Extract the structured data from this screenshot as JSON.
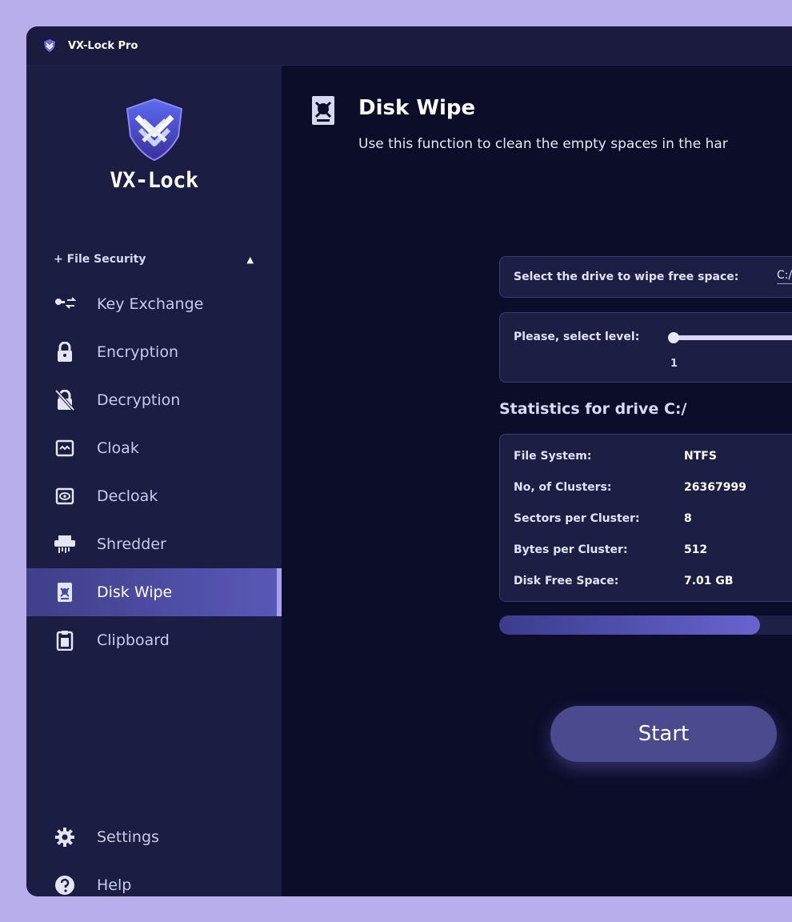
{
  "window": {
    "title": "VX-Lock Pro"
  },
  "sidebar": {
    "logo_text": "VX-Lock",
    "section_label": "+ File Security",
    "items": [
      {
        "label": "Key Exchange",
        "icon": "key-exchange-icon"
      },
      {
        "label": "Encryption",
        "icon": "lock-icon"
      },
      {
        "label": "Decryption",
        "icon": "unlock-icon"
      },
      {
        "label": "Cloak",
        "icon": "cloak-icon"
      },
      {
        "label": "Decloak",
        "icon": "eye-icon"
      },
      {
        "label": "Shredder",
        "icon": "shredder-icon"
      },
      {
        "label": "Disk Wipe",
        "icon": "disk-wipe-icon",
        "active": true
      },
      {
        "label": "Clipboard",
        "icon": "clipboard-icon"
      }
    ],
    "bottom_items": [
      {
        "label": "Settings",
        "icon": "gear-icon"
      },
      {
        "label": "Help",
        "icon": "help-icon"
      }
    ]
  },
  "main": {
    "title": "Disk Wipe",
    "description": "Use this function to clean the empty spaces in the har",
    "drive_label": "Select the drive to wipe free space:",
    "drive_value": "C:/",
    "level_label": "Please, select level:",
    "level_value": "1",
    "stats_title": "Statistics for drive C:/",
    "stats": [
      {
        "key": "File System:",
        "value": "NTFS"
      },
      {
        "key": "No, of Clusters:",
        "value": "26367999"
      },
      {
        "key": "Sectors per Cluster:",
        "value": "8"
      },
      {
        "key": "Bytes per Cluster:",
        "value": "512"
      },
      {
        "key": "Disk Free Space:",
        "value": "7.01 GB"
      }
    ],
    "progress_fraction": 0.5,
    "start_label": "Start"
  },
  "colors": {
    "background": "#b8aeec",
    "window": "#0c0d29",
    "sidebar": "#1c1d42",
    "accent": "#5a58b8",
    "card": "#1d1e44"
  }
}
